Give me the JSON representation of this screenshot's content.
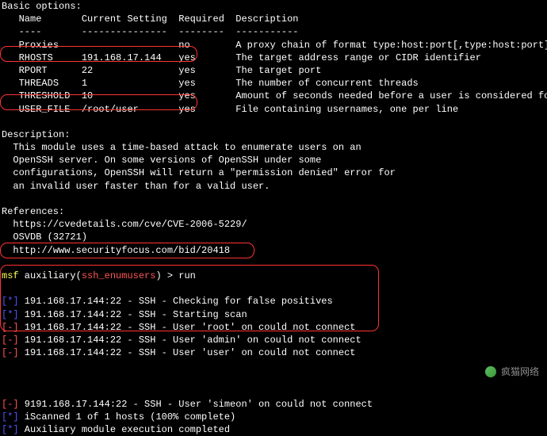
{
  "options_header": "Basic options:",
  "table_headers": {
    "c1": "Name",
    "c2": "Current Setting",
    "c3": "Required",
    "c4": "Description"
  },
  "table_divider": {
    "c1": "----",
    "c2": "---------------",
    "c3": "--------",
    "c4": "-----------"
  },
  "options": [
    {
      "name": "Proxies",
      "setting": "",
      "required": "no",
      "desc": "A proxy chain of format type:host:port[,type:host:port][...]"
    },
    {
      "name": "RHOSTS",
      "setting": "191.168.17.144",
      "required": "yes",
      "desc": "The target address range or CIDR identifier"
    },
    {
      "name": "RPORT",
      "setting": "22",
      "required": "yes",
      "desc": "The target port"
    },
    {
      "name": "THREADS",
      "setting": "1",
      "required": "yes",
      "desc": "The number of concurrent threads"
    },
    {
      "name": "THRESHOLD",
      "setting": "10",
      "required": "yes",
      "desc": "Amount of seconds needed before a user is considered found"
    },
    {
      "name": "USER_FILE",
      "setting": "/root/user",
      "required": "yes",
      "desc": "File containing usernames, one per line"
    }
  ],
  "description": {
    "title": "Description:",
    "lines": [
      "This module uses a time-based attack to enumerate users on an",
      "OpenSSH server. On some versions of OpenSSH under some",
      "configurations, OpenSSH will return a \"permission denied\" error for",
      "an invalid user faster than for a valid user."
    ]
  },
  "references": {
    "title": "References:",
    "lines": [
      "https://cvedetails.com/cve/CVE-2006-5229/",
      "OSVDB (32721)",
      "http://www.securityfocus.com/bid/20418"
    ]
  },
  "prompt": {
    "msf": "msf",
    "aux_open": " auxiliary(",
    "module": "ssh_enumusers",
    "aux_close": ") > ",
    "cmd": "run"
  },
  "run1": [
    {
      "br": "[*]",
      "msg": " 191.168.17.144:22 - SSH - Checking for false positives"
    },
    {
      "br": "[*]",
      "msg": " 191.168.17.144:22 - SSH - Starting scan"
    },
    {
      "br": "[-]",
      "msg": " 191.168.17.144:22 - SSH - User 'root' on could not connect"
    },
    {
      "br": "[-]",
      "msg": " 191.168.17.144:22 - SSH - User 'admin' on could not connect"
    },
    {
      "br": "[-]",
      "msg": " 191.168.17.144:22 - SSH - User 'user' on could not connect"
    }
  ],
  "run2": [
    {
      "br": "[-]",
      "msg": " 9191.168.17.144:22 - SSH - User 'simeon' on could not connect",
      "c": "red"
    },
    {
      "br": "[*]",
      "msg": " iScanned 1 of 1 hosts (100% complete)",
      "c": "blue"
    },
    {
      "br": "[*]",
      "msg": " Auxiliary module execution completed",
      "c": "blue"
    }
  ],
  "watermark": "疯猫网络"
}
